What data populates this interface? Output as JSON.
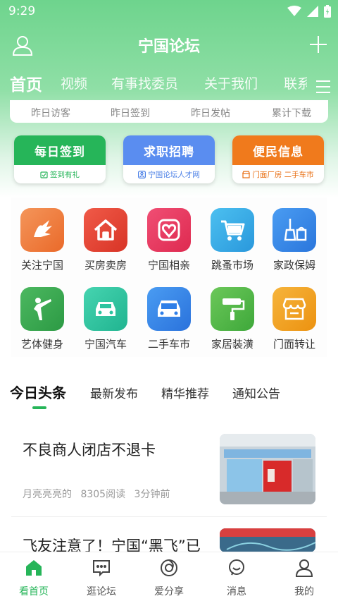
{
  "status_bar": {
    "time": "9:29"
  },
  "app_bar": {
    "title": "宁国论坛"
  },
  "tabs": [
    {
      "label": "首页",
      "active": true
    },
    {
      "label": "视频"
    },
    {
      "label": "有事找委员"
    },
    {
      "label": "关于我们"
    },
    {
      "label": "联系"
    }
  ],
  "stats": [
    "昨日访客",
    "昨日签到",
    "昨日发帖",
    "累计下载"
  ],
  "actions": [
    {
      "title": "每日签到",
      "subtitle": "签到有礼",
      "color": "#26b559"
    },
    {
      "title": "求职招聘",
      "subtitle": "宁国论坛人才网",
      "color": "#5a8df0"
    },
    {
      "title": "便民信息",
      "subtitle": "门面厂房 二手车市",
      "color": "#f07a1c"
    }
  ],
  "grid": [
    {
      "label": "关注宁国",
      "icon": "hand-icon",
      "color": "#f07a3c"
    },
    {
      "label": "买房卖房",
      "icon": "house-icon",
      "color": "#e8463a"
    },
    {
      "label": "宁国相亲",
      "icon": "heart-icon",
      "color": "#e8365a"
    },
    {
      "label": "跳蚤市场",
      "icon": "cart-icon",
      "color": "#3aaee8"
    },
    {
      "label": "家政保姆",
      "icon": "broom-icon",
      "color": "#2f8ae8"
    },
    {
      "label": "艺体健身",
      "icon": "fitness-icon",
      "color": "#34a853"
    },
    {
      "label": "宁国汽车",
      "icon": "car-icon",
      "color": "#2ec4a0"
    },
    {
      "label": "二手车市",
      "icon": "used-car-icon",
      "color": "#2f7fe8"
    },
    {
      "label": "家居装潢",
      "icon": "paint-roller-icon",
      "color": "#4cb84a"
    },
    {
      "label": "门面转让",
      "icon": "storefront-icon",
      "color": "#f0a020"
    }
  ],
  "news_tabs": [
    {
      "label": "今日头条",
      "active": true
    },
    {
      "label": "最新发布"
    },
    {
      "label": "精华推荐"
    },
    {
      "label": "通知公告"
    }
  ],
  "news": [
    {
      "title": "不良商人闭店不退卡",
      "author": "月亮亮亮的",
      "reads": "8305阅读",
      "time": "3分钟前"
    },
    {
      "title": "飞友注意了！宁国“黑飞”已",
      "author": "",
      "reads": "",
      "time": ""
    }
  ],
  "bottom_nav": [
    {
      "label": "看首页",
      "active": true
    },
    {
      "label": "逛论坛"
    },
    {
      "label": "爱分享"
    },
    {
      "label": "消息"
    },
    {
      "label": "我的"
    }
  ]
}
